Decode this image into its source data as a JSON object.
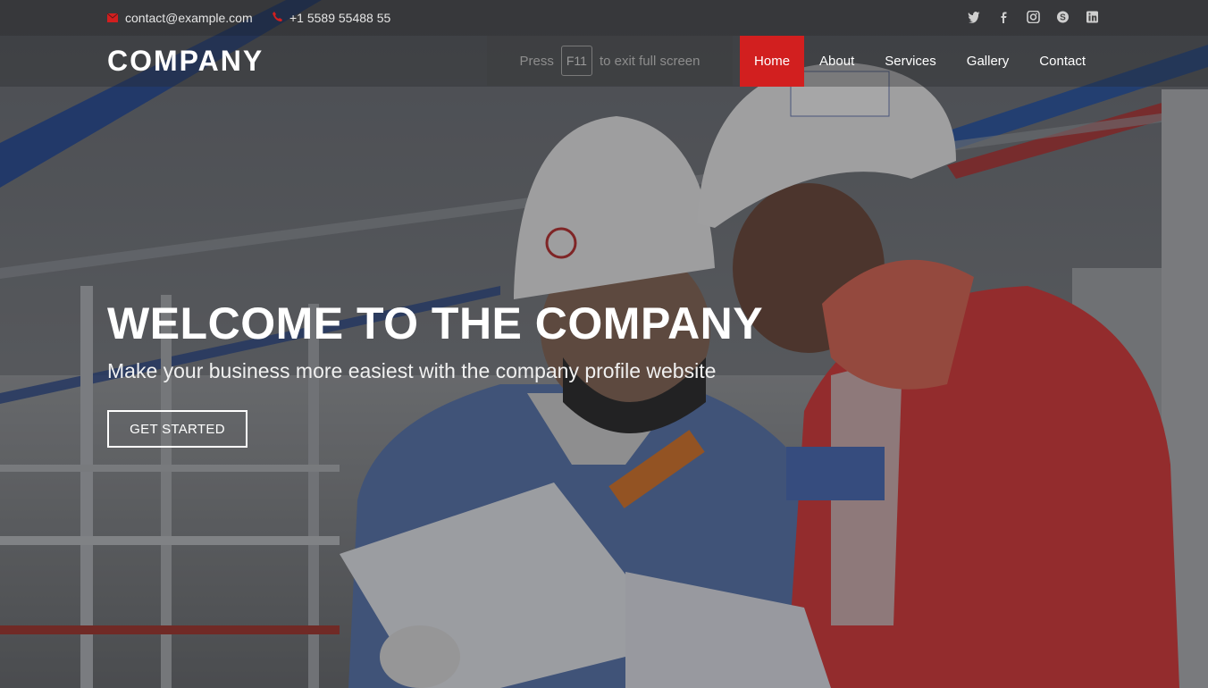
{
  "topbar": {
    "email": "contact@example.com",
    "phone": "+1 5589 55488 55",
    "email_icon": "envelope-icon",
    "phone_icon": "phone-icon",
    "social": [
      "twitter-icon",
      "facebook-icon",
      "instagram-icon",
      "skype-icon",
      "linkedin-icon"
    ]
  },
  "header": {
    "logo": "COMPANY",
    "fullscreen_hint": {
      "before": "Press",
      "key": "F11",
      "after": "to exit full screen"
    },
    "nav": [
      "Home",
      "About",
      "Services",
      "Gallery",
      "Contact"
    ],
    "active_nav": "Home"
  },
  "hero": {
    "title": "WELCOME TO THE COMPANY",
    "subtitle": "Make your business more easiest with the company profile website",
    "cta": "GET STARTED"
  },
  "colors": {
    "accent": "#d21f1f",
    "text": "#ffffff"
  }
}
